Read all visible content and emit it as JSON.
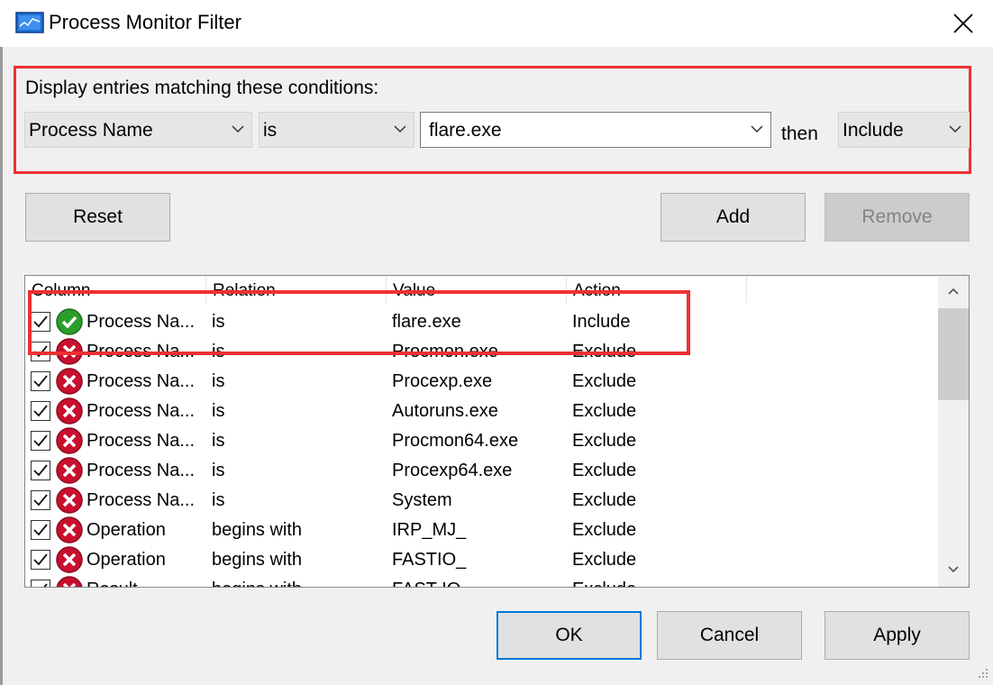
{
  "window": {
    "title": "Process Monitor Filter"
  },
  "condition": {
    "label": "Display entries matching these conditions:",
    "column": "Process Name",
    "relation": "is",
    "value": "flare.exe",
    "then_label": "then",
    "action": "Include"
  },
  "buttons": {
    "reset": "Reset",
    "add": "Add",
    "remove": "Remove",
    "ok": "OK",
    "cancel": "Cancel",
    "apply": "Apply"
  },
  "list": {
    "headers": [
      "Column",
      "Relation",
      "Value",
      "Action"
    ],
    "rows": [
      {
        "checked": true,
        "status": "include",
        "column": "Process Na...",
        "relation": "is",
        "value": "flare.exe",
        "action": "Include"
      },
      {
        "checked": true,
        "status": "exclude",
        "column": "Process Na...",
        "relation": "is",
        "value": "Procmon.exe",
        "action": "Exclude"
      },
      {
        "checked": true,
        "status": "exclude",
        "column": "Process Na...",
        "relation": "is",
        "value": "Procexp.exe",
        "action": "Exclude"
      },
      {
        "checked": true,
        "status": "exclude",
        "column": "Process Na...",
        "relation": "is",
        "value": "Autoruns.exe",
        "action": "Exclude"
      },
      {
        "checked": true,
        "status": "exclude",
        "column": "Process Na...",
        "relation": "is",
        "value": "Procmon64.exe",
        "action": "Exclude"
      },
      {
        "checked": true,
        "status": "exclude",
        "column": "Process Na...",
        "relation": "is",
        "value": "Procexp64.exe",
        "action": "Exclude"
      },
      {
        "checked": true,
        "status": "exclude",
        "column": "Process Na...",
        "relation": "is",
        "value": "System",
        "action": "Exclude"
      },
      {
        "checked": true,
        "status": "exclude",
        "column": "Operation",
        "relation": "begins with",
        "value": "IRP_MJ_",
        "action": "Exclude"
      },
      {
        "checked": true,
        "status": "exclude",
        "column": "Operation",
        "relation": "begins with",
        "value": "FASTIO_",
        "action": "Exclude"
      },
      {
        "checked": true,
        "status": "exclude",
        "column": "Result",
        "relation": "begins with",
        "value": "FAST IO",
        "action": "Exclude"
      }
    ]
  },
  "colors": {
    "highlight": "#ee3030",
    "default_button_border": "#0078d7",
    "include_icon": "#2a9d2a",
    "exclude_icon": "#c8102e"
  }
}
